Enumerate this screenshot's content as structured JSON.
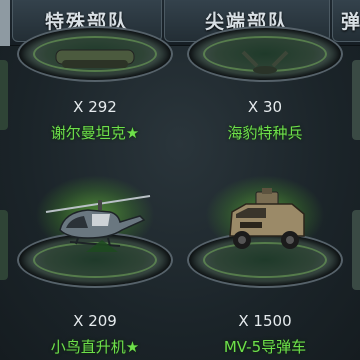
{
  "tabs": [
    {
      "label": "特殊部队"
    },
    {
      "label": "尖端部队"
    },
    {
      "label": "弹"
    }
  ],
  "units": [
    {
      "count": "X 292",
      "name": "谢尔曼坦克★",
      "icon": "tank-icon"
    },
    {
      "count": "X 30",
      "name": "海豹特种兵",
      "icon": "soldier-icon"
    },
    {
      "count": "X 209",
      "name": "小鸟直升机★",
      "icon": "helicopter-icon"
    },
    {
      "count": "X 1500",
      "name": "MV-5导弹车",
      "icon": "missile-vehicle-icon"
    }
  ],
  "colors": {
    "name_text": "#6ee04a",
    "glow": "#78dc3c"
  }
}
